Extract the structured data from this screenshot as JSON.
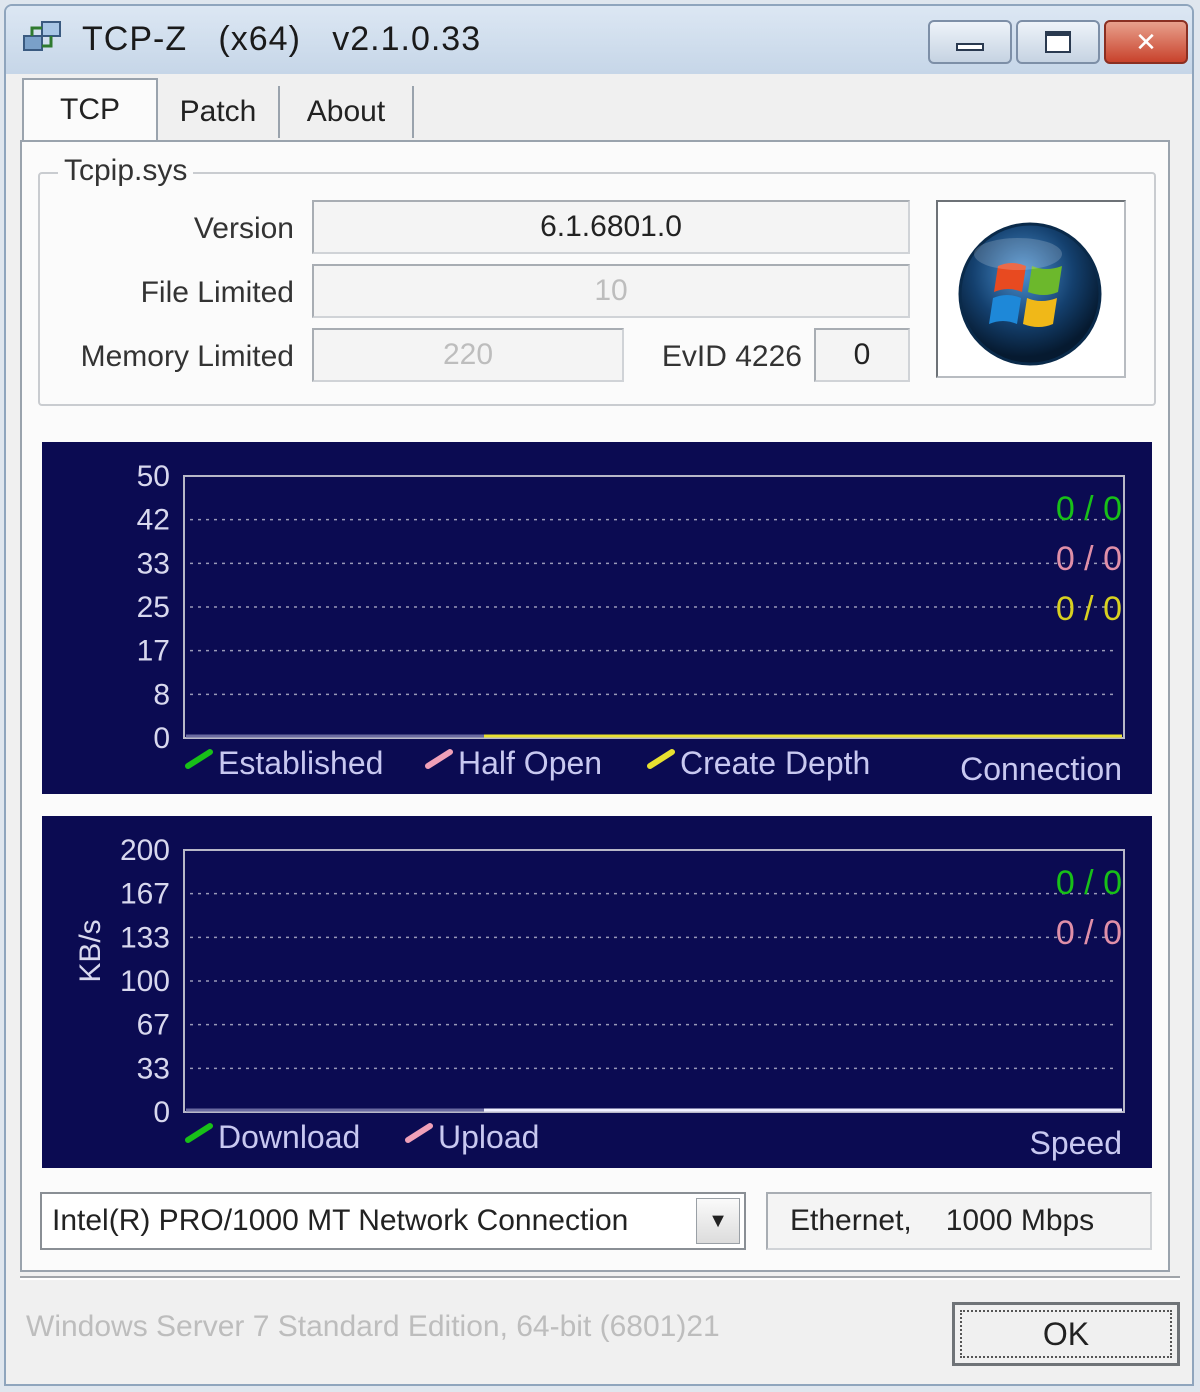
{
  "window": {
    "title": "TCP-Z   (x64)   v2.1.0.33",
    "controls": {
      "minimize": "minimize",
      "maximize": "maximize",
      "close": "✕"
    }
  },
  "tabs": [
    {
      "label": "TCP",
      "selected": true
    },
    {
      "label": "Patch",
      "selected": false
    },
    {
      "label": "About",
      "selected": false
    }
  ],
  "tcpip": {
    "group_label": "Tcpip.sys",
    "version_label": "Version",
    "version_value": "6.1.6801.0",
    "file_limited_label": "File Limited",
    "file_limited_value": "10",
    "memory_limited_label": "Memory Limited",
    "memory_limited_value": "220",
    "evid_label": "EvID 4226",
    "evid_value": "0",
    "logo": "windows-logo-icon"
  },
  "connection_graph": {
    "y_ticks": [
      "50",
      "42",
      "33",
      "25",
      "17",
      "8",
      "0"
    ],
    "readouts": [
      {
        "text": "0 / 0",
        "color": "#18c018"
      },
      {
        "text": "0 / 0",
        "color": "#e08fa8"
      },
      {
        "text": "0 / 0",
        "color": "#d8d020"
      }
    ],
    "legend": [
      {
        "label": "Established",
        "color": "#18c018"
      },
      {
        "label": "Half Open",
        "color": "#f0a0b8"
      },
      {
        "label": "Create Depth",
        "color": "#e8e030"
      }
    ],
    "caption": "Connection"
  },
  "speed_graph": {
    "y_axis_label": "KB/s",
    "y_ticks": [
      "200",
      "167",
      "133",
      "100",
      "67",
      "33",
      "0"
    ],
    "readouts": [
      {
        "text": "0 / 0",
        "color": "#18c018"
      },
      {
        "text": "0 / 0",
        "color": "#e08fa8"
      }
    ],
    "legend": [
      {
        "label": "Download",
        "color": "#18c018"
      },
      {
        "label": "Upload",
        "color": "#f0a0b8"
      }
    ],
    "caption": "Speed"
  },
  "adapter": {
    "selected": "Intel(R) PRO/1000 MT Network Connection",
    "type": "Ethernet,",
    "speed": "1000 Mbps"
  },
  "footer": {
    "os_text": "Windows Server 7 Standard Edition, 64-bit (6801)21",
    "ok_label": "OK"
  }
}
